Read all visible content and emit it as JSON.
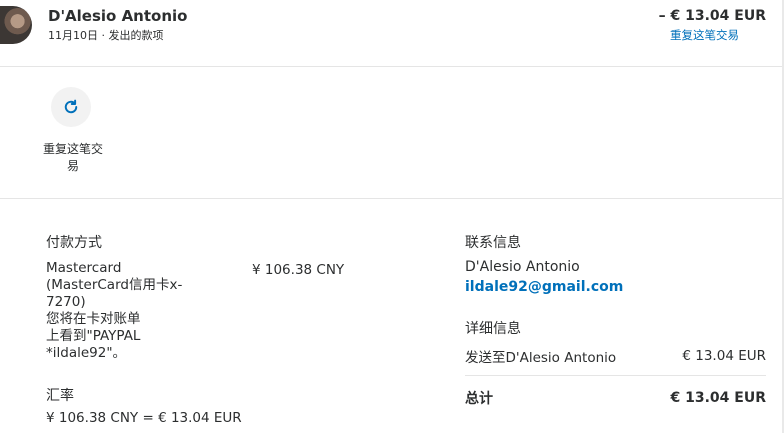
{
  "header": {
    "name": "D'Alesio Antonio",
    "date": "11月10日",
    "separator": "·",
    "type": "发出的款项",
    "amount": "– € 13.04 EUR",
    "repeat_link": "重复这笔交易"
  },
  "actions": {
    "repeat_icon": "refresh-icon",
    "repeat_label": "重复这笔交易"
  },
  "payment": {
    "title": "付款方式",
    "method_lines": [
      "Mastercard",
      "(MasterCard信用卡x-",
      "7270)",
      "您将在卡对账单",
      "上看到\"PAYPAL",
      "*ildale92\"。"
    ],
    "amount": "¥ 106.38 CNY"
  },
  "exchange": {
    "title": "汇率",
    "value": "¥ 106.38 CNY = € 13.04 EUR"
  },
  "contact": {
    "title": "联系信息",
    "name": "D'Alesio Antonio",
    "email": "ildale92@gmail.com"
  },
  "details": {
    "title": "详细信息",
    "sent_label": "发送至D'Alesio Antonio",
    "sent_value": "€ 13.04 EUR",
    "total_label": "总计",
    "total_value": "€ 13.04 EUR"
  },
  "colors": {
    "link": "#0070ba",
    "text": "#2c2e2f",
    "divider": "#e5e5e5"
  }
}
